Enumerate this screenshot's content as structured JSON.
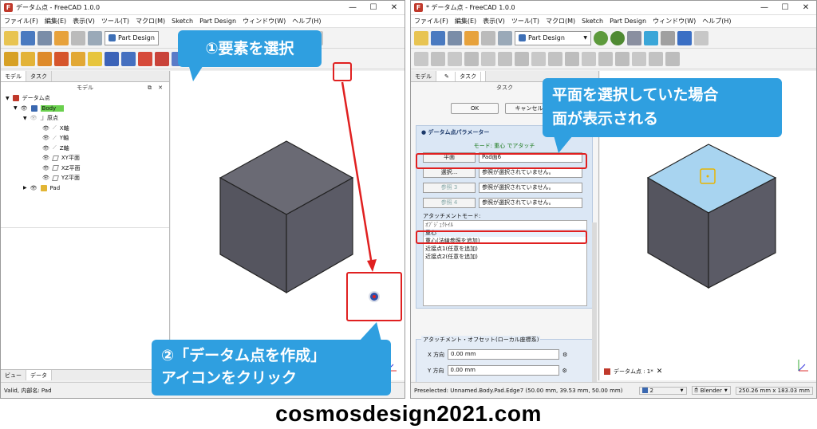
{
  "left": {
    "title": "データム点 - FreeCAD 1.0.0",
    "menu": [
      "ファイル(F)",
      "編集(E)",
      "表示(V)",
      "ツール(T)",
      "マクロ(M)",
      "Sketch",
      "Part Design",
      "ウィンドウ(W)",
      "ヘルプ(H)"
    ],
    "workbench": "Part Design",
    "tabs": {
      "model": "モデル",
      "task": "タスク"
    },
    "pane_title": "モデル",
    "tree": [
      {
        "label": "データム点"
      },
      {
        "label": "Body"
      },
      {
        "label": "原点"
      },
      {
        "label": "X軸"
      },
      {
        "label": "Y軸"
      },
      {
        "label": "Z軸"
      },
      {
        "label": "XY平面"
      },
      {
        "label": "XZ平面"
      },
      {
        "label": "YZ平面"
      },
      {
        "label": "Pad"
      }
    ],
    "bottom_tabs": {
      "view": "ビュー",
      "data": "データ"
    },
    "status": "Valid, 内部名: Pad"
  },
  "right": {
    "title": "* データム点 - FreeCAD 1.0.0",
    "menu": [
      "ファイル(F)",
      "編集(E)",
      "表示(V)",
      "ツール(T)",
      "マクロ(M)",
      "Sketch",
      "Part Design",
      "ウィンドウ(W)",
      "ヘルプ(H)"
    ],
    "workbench": "Part Design",
    "tabs": {
      "model": "モデル",
      "task": "タスク"
    },
    "pane_title": "タスク",
    "ok": "OK",
    "cancel": "キャンセル",
    "section_title": "データム点パラメーター",
    "mode_caption": "モード: 重心 でアタッチ",
    "refs": [
      {
        "button": "平面",
        "value": "Pad面6"
      },
      {
        "button": "選択...",
        "value": "参照が選択されていません。"
      },
      {
        "button": "参照 3",
        "value": "参照が選択されていません。"
      },
      {
        "button": "参照 4",
        "value": "参照が選択されていません。"
      }
    ],
    "attach_mode_label": "アタッチメントモード:",
    "modes": [
      "ｵﾌﾞｼﾞｪｸﾄｲﾙ",
      "重心",
      "重心(法線参照を追加)",
      "近接点1(任意を追加)",
      "近接点2(任意を追加)"
    ],
    "offset_title": "アタッチメント・オフセット(ローカル座標系)",
    "offsets": [
      {
        "label": "X 方向",
        "value": "0.00 mm"
      },
      {
        "label": "Y 方向",
        "value": "0.00 mm"
      }
    ],
    "doc_tab": "データム点 : 1*",
    "status": {
      "preselected": "Preselected: Unnamed.Body.Pad.Edge7 (50.00 mm, 39.53 mm, 50.00 mm)",
      "count": "2",
      "nav": "Blender",
      "dims": "250.26 mm x 183.03 mm"
    }
  },
  "callouts": {
    "c1": "①要素を選択",
    "c2_line1": "②「データム点を作成」",
    "c2_line2": "アイコンをクリック",
    "c3_line1": "平面を選択していた場合",
    "c3_line2": "面が表示される"
  },
  "footer": "cosmosdesign2021.com",
  "colors": {
    "callout": "#2f9fe0",
    "highlight": "#e02020",
    "cube_side": "#5b5b66",
    "selected_face": "#a8d4f0",
    "tree_selected": "#6ad04e"
  }
}
